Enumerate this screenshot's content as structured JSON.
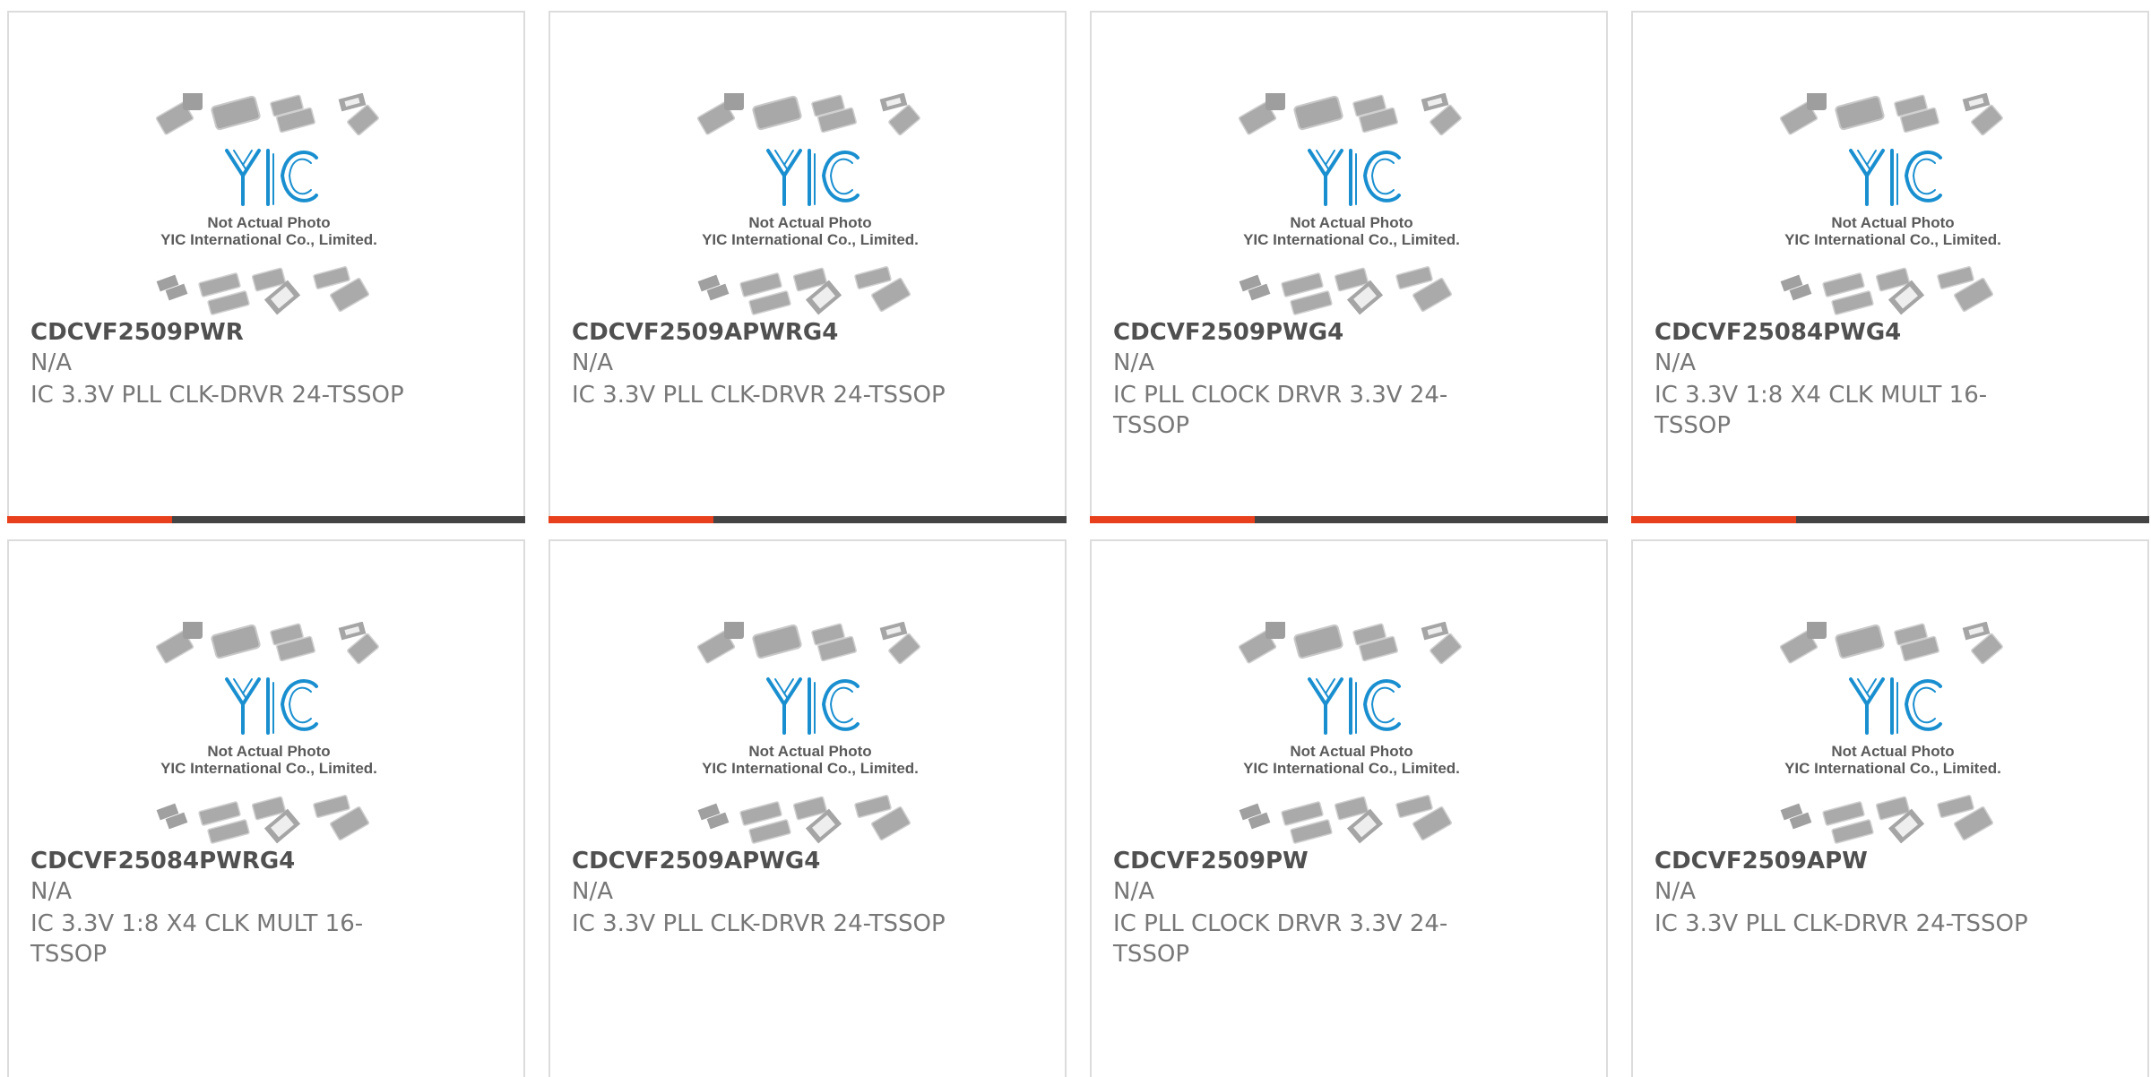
{
  "image": {
    "caption_line1": "Not Actual Photo",
    "caption_line2": "YIC International Co., Limited.",
    "logo_text": "YIC"
  },
  "colors": {
    "accent": "#e8401c",
    "bar": "#444444",
    "logo": "#1a8fd0"
  },
  "products": [
    {
      "part_number": "CDCVF2509PWR",
      "manufacturer": "N/A",
      "description": "IC 3.3V PLL CLK-DRVR 24-TSSOP"
    },
    {
      "part_number": "CDCVF2509APWRG4",
      "manufacturer": "N/A",
      "description": "IC 3.3V PLL CLK-DRVR 24-TSSOP"
    },
    {
      "part_number": "CDCVF2509PWG4",
      "manufacturer": "N/A",
      "description": "IC PLL CLOCK DRVR 3.3V 24-TSSOP"
    },
    {
      "part_number": "CDCVF25084PWG4",
      "manufacturer": "N/A",
      "description": "IC 3.3V 1:8 X4 CLK MULT 16-TSSOP"
    },
    {
      "part_number": "CDCVF25084PWRG4",
      "manufacturer": "N/A",
      "description": "IC 3.3V 1:8 X4 CLK MULT 16-TSSOP"
    },
    {
      "part_number": "CDCVF2509APWG4",
      "manufacturer": "N/A",
      "description": "IC 3.3V PLL CLK-DRVR 24-TSSOP"
    },
    {
      "part_number": "CDCVF2509PW",
      "manufacturer": "N/A",
      "description": "IC PLL CLOCK DRVR 3.3V 24-TSSOP"
    },
    {
      "part_number": "CDCVF2509APW",
      "manufacturer": "N/A",
      "description": "IC 3.3V PLL CLK-DRVR 24-TSSOP"
    }
  ]
}
